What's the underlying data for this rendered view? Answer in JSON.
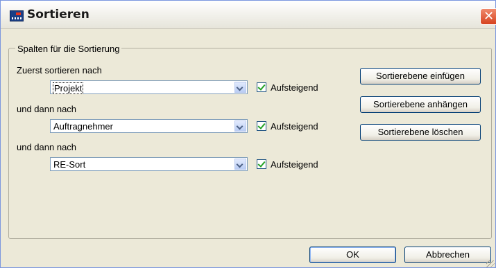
{
  "window": {
    "title": "Sortieren",
    "icon": "app-icon",
    "close_symbol": "✕"
  },
  "group": {
    "legend": "Spalten für die Sortierung"
  },
  "sort_levels": [
    {
      "label": "Zuerst sortieren nach",
      "value": "Projekt",
      "ascending_label": "Aufsteigend",
      "ascending": true
    },
    {
      "label": "und dann nach",
      "value": "Auftragnehmer",
      "ascending_label": "Aufsteigend",
      "ascending": true
    },
    {
      "label": "und dann nach",
      "value": "RE-Sort",
      "ascending_label": "Aufsteigend",
      "ascending": true
    }
  ],
  "side_buttons": {
    "insert": "Sortierebene einfügen",
    "append": "Sortierebene anhängen",
    "delete": "Sortierebene löschen"
  },
  "footer": {
    "ok": "OK",
    "cancel": "Abbrechen"
  },
  "colors": {
    "dialog_bg": "#ece9d8",
    "button_border": "#003c74",
    "check_mark": "#21a121",
    "close_button": "#d6421f"
  }
}
